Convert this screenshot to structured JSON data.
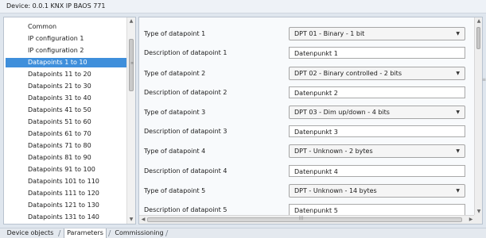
{
  "window": {
    "title": "Device: 0.0.1  KNX IP BAOS 771"
  },
  "nav": {
    "items": [
      {
        "label": "Common",
        "selected": false
      },
      {
        "label": "IP configuration 1",
        "selected": false
      },
      {
        "label": "IP configuration 2",
        "selected": false
      },
      {
        "label": "Datapoints 1 to 10",
        "selected": true
      },
      {
        "label": "Datapoints 11 to 20",
        "selected": false
      },
      {
        "label": "Datapoints 21 to 30",
        "selected": false
      },
      {
        "label": "Datapoints 31 to 40",
        "selected": false
      },
      {
        "label": "Datapoints 41 to 50",
        "selected": false
      },
      {
        "label": "Datapoints 51 to 60",
        "selected": false
      },
      {
        "label": "Datapoints 61 to 70",
        "selected": false
      },
      {
        "label": "Datapoints 71 to 80",
        "selected": false
      },
      {
        "label": "Datapoints 81 to 90",
        "selected": false
      },
      {
        "label": "Datapoints 91 to 100",
        "selected": false
      },
      {
        "label": "Datapoints 101 to 110",
        "selected": false
      },
      {
        "label": "Datapoints 111 to 120",
        "selected": false
      },
      {
        "label": "Datapoints 121 to 130",
        "selected": false
      },
      {
        "label": "Datapoints 131 to 140",
        "selected": false
      }
    ]
  },
  "settings": {
    "datapoints": [
      {
        "type_label": "Type of datapoint 1",
        "type_value": "DPT 01 - Binary - 1 bit",
        "desc_label": "Description of datapoint 1",
        "desc_value": "Datenpunkt 1"
      },
      {
        "type_label": "Type of datapoint 2",
        "type_value": "DPT 02 - Binary controlled - 2 bits",
        "desc_label": "Description of datapoint 2",
        "desc_value": "Datenpunkt 2"
      },
      {
        "type_label": "Type of datapoint 3",
        "type_value": "DPT 03 - Dim up/down - 4 bits",
        "desc_label": "Description of datapoint 3",
        "desc_value": "Datenpunkt 3"
      },
      {
        "type_label": "Type of datapoint 4",
        "type_value": "DPT - Unknown - 2 bytes",
        "desc_label": "Description of datapoint 4",
        "desc_value": "Datenpunkt 4"
      },
      {
        "type_label": "Type of datapoint 5",
        "type_value": "DPT - Unknown - 14 bytes",
        "desc_label": "Description of datapoint 5",
        "desc_value": "Datenpunkt 5"
      }
    ]
  },
  "tabs": [
    {
      "label": "Device objects",
      "active": false
    },
    {
      "label": "Parameters",
      "active": true
    },
    {
      "label": "Commissioning",
      "active": false
    }
  ],
  "icons": {
    "dropdown": "chevron-down-icon",
    "scroll_up": "arrow-up-icon",
    "scroll_down": "arrow-down-icon",
    "scroll_left": "arrow-left-icon",
    "scroll_right": "arrow-right-icon"
  },
  "colors": {
    "selection": "#3f8fdb",
    "panel_background": "#dfe6ee",
    "title_background": "#eef2f7"
  }
}
